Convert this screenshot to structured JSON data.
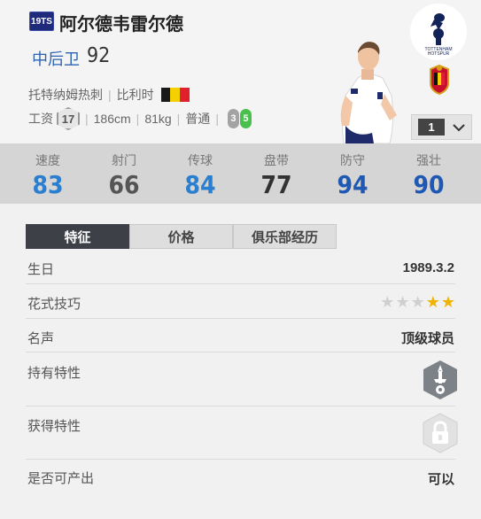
{
  "player": {
    "season_badge": "19TS",
    "name": "阿尔德韦雷尔德",
    "position": "中后卫",
    "ovr": "92",
    "club": "托特纳姆热刺",
    "nation": "比利时",
    "wage_label": "工资",
    "wage": "17",
    "height": "186cm",
    "weight": "81kg",
    "body_type": "普通",
    "weak_foot": "3",
    "strong_foot": "5",
    "level": "1"
  },
  "colors": {
    "position_blue": "#2c63b3",
    "stat_blue": "#2b7fd0",
    "stat_dark_blue": "#1f59b3",
    "stat_gray": "#555555",
    "stat_dark": "#333333",
    "foot_green": "#49c04d",
    "tab_active": "#3e4048",
    "star_gold": "#f0b400"
  },
  "stats": [
    {
      "label": "速度",
      "value": "83",
      "color": "#2b7fd0"
    },
    {
      "label": "射门",
      "value": "66",
      "color": "#555555"
    },
    {
      "label": "传球",
      "value": "84",
      "color": "#2b7fd0"
    },
    {
      "label": "盘带",
      "value": "77",
      "color": "#333333"
    },
    {
      "label": "防守",
      "value": "94",
      "color": "#1f59b3"
    },
    {
      "label": "强壮",
      "value": "90",
      "color": "#1f59b3"
    }
  ],
  "tabs": [
    "特征",
    "价格",
    "俱乐部经历"
  ],
  "details": {
    "birthday_label": "生日",
    "birthday": "1989.3.2",
    "skill_moves_label": "花式技巧",
    "skill_moves": 2,
    "skill_moves_max": 5,
    "reputation_label": "名声",
    "reputation": "顶级球员",
    "traits_label": "持有特性",
    "traits_icon": "defender-trait-icon",
    "acquired_traits_label": "获得特性",
    "acquired_traits_icon": "lock-icon",
    "obtainable_label": "是否可产出",
    "obtainable": "可以"
  }
}
